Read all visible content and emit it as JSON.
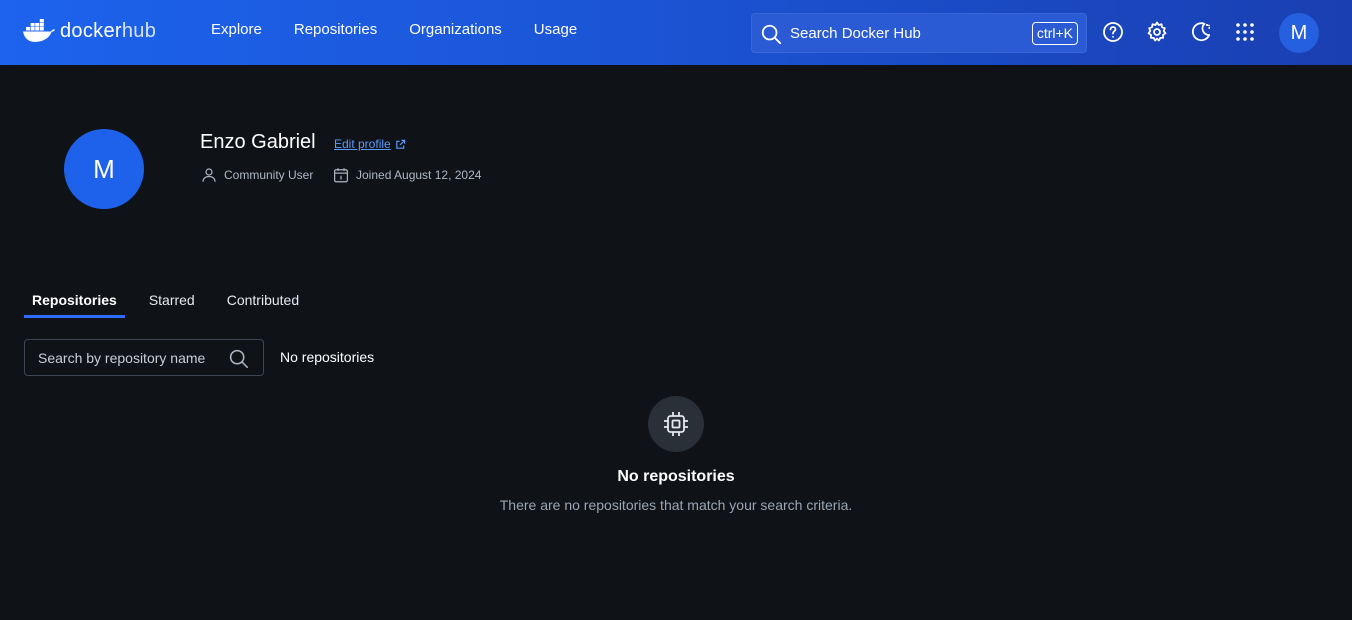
{
  "brand": {
    "name": "docker",
    "suffix": "hub"
  },
  "nav": {
    "items": [
      {
        "label": "Explore"
      },
      {
        "label": "Repositories"
      },
      {
        "label": "Organizations"
      },
      {
        "label": "Usage"
      }
    ]
  },
  "search": {
    "placeholder": "Search Docker Hub",
    "shortcut": "ctrl+K"
  },
  "header_icons": [
    "help-icon",
    "gear-icon",
    "theme-toggle-icon",
    "apps-grid-icon"
  ],
  "user": {
    "initial": "M"
  },
  "profile": {
    "initial": "M",
    "name": "Enzo Gabriel",
    "edit_label": "Edit profile",
    "role": "Community User",
    "joined": "Joined August 12, 2024"
  },
  "tabs": [
    {
      "label": "Repositories",
      "active": true
    },
    {
      "label": "Starred",
      "active": false
    },
    {
      "label": "Contributed",
      "active": false
    }
  ],
  "repo_search": {
    "placeholder": "Search by repository name"
  },
  "repo_count_label": "No repositories",
  "empty_state": {
    "icon": "chip-icon",
    "title": "No repositories",
    "description": "There are no repositories that match your search criteria."
  },
  "colors": {
    "nav_bg": "#1d63ed",
    "page_bg": "#0f1217",
    "accent": "#2d6bff",
    "link": "#5b9bff"
  }
}
